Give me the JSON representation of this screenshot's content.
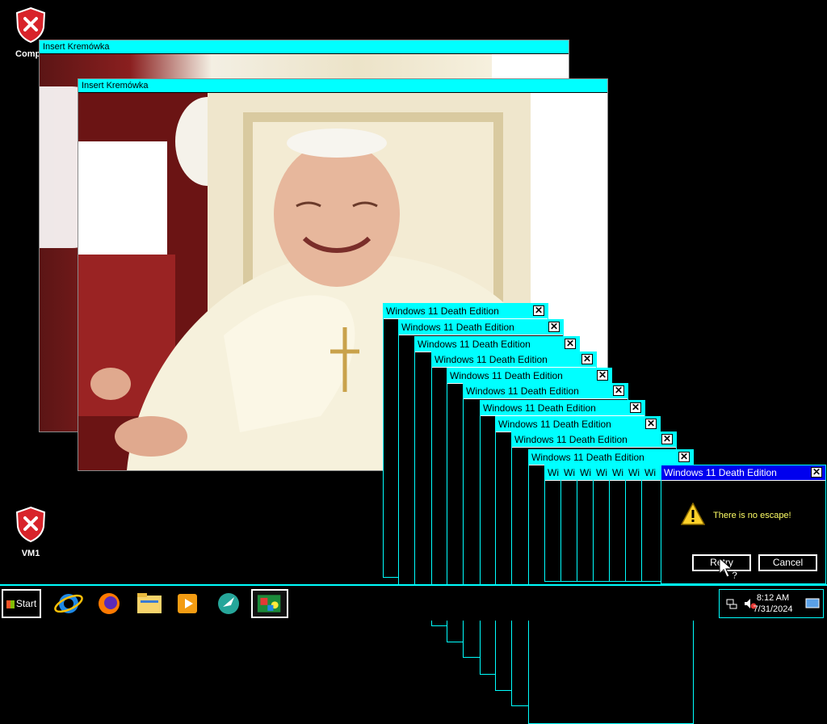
{
  "desktop": {
    "icons": [
      {
        "label": "Compu",
        "icon": "shield-error-icon"
      },
      {
        "label": "VM1",
        "icon": "shield-error-icon"
      }
    ]
  },
  "windows": {
    "kremowka_title": "Insert Kremówka",
    "death_title": "Windows 11 Death Edition",
    "death_title_short": "Wi",
    "dialog": {
      "message": "There is no escape!",
      "retry_label": "Retry",
      "cancel_label": "Cancel",
      "icon": "warning-icon"
    }
  },
  "taskbar": {
    "start_label": "Start",
    "apps": [
      "internet-explorer-icon",
      "firefox-icon",
      "file-explorer-icon",
      "media-player-icon",
      "globe-arrow-icon",
      "paint-app-icon"
    ],
    "clock_time": "8:12 AM",
    "clock_date": "7/31/2024",
    "tray_icons": [
      "network-icon",
      "volume-muted-icon",
      "show-desktop-icon"
    ]
  },
  "colors": {
    "title_bar": "#00ffff",
    "active_title_bar": "#0000ee",
    "dialog_text": "#ffff66",
    "desktop": "#000000"
  }
}
